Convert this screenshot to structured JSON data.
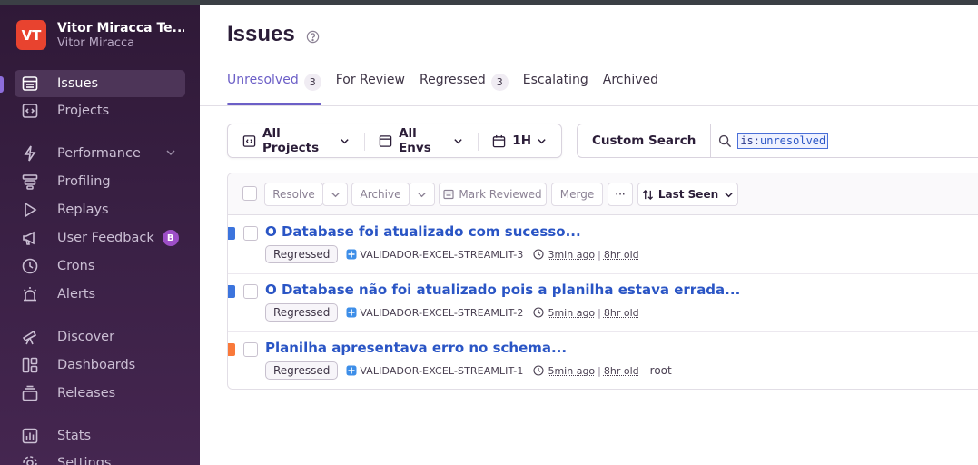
{
  "org": {
    "initials": "VT",
    "name": "Vitor Miracca Te...",
    "user": "Vitor Miracca"
  },
  "sidebar": {
    "items": [
      {
        "label": "Issues",
        "icon": "issues-icon"
      },
      {
        "label": "Projects",
        "icon": "projects-icon"
      },
      {
        "label": "Performance",
        "icon": "lightning-icon"
      },
      {
        "label": "Profiling",
        "icon": "profiling-icon"
      },
      {
        "label": "Replays",
        "icon": "play-icon"
      },
      {
        "label": "User Feedback",
        "icon": "megaphone-icon",
        "badge": "B"
      },
      {
        "label": "Crons",
        "icon": "clock-icon"
      },
      {
        "label": "Alerts",
        "icon": "siren-icon"
      },
      {
        "label": "Discover",
        "icon": "telescope-icon"
      },
      {
        "label": "Dashboards",
        "icon": "dashboard-icon"
      },
      {
        "label": "Releases",
        "icon": "releases-icon"
      },
      {
        "label": "Stats",
        "icon": "stats-icon"
      },
      {
        "label": "Settings",
        "icon": "gear-icon"
      }
    ]
  },
  "header": {
    "title": "Issues"
  },
  "tabs": [
    {
      "label": "Unresolved",
      "count": "3"
    },
    {
      "label": "For Review"
    },
    {
      "label": "Regressed",
      "count": "3"
    },
    {
      "label": "Escalating"
    },
    {
      "label": "Archived"
    }
  ],
  "filters": {
    "projects": "All Projects",
    "envs": "All Envs",
    "period": "1H"
  },
  "search": {
    "custom": "Custom Search",
    "token_key": "is:",
    "token_value": "unresolved"
  },
  "actions": {
    "resolve": "Resolve",
    "archive": "Archive",
    "mark_reviewed": "Mark Reviewed",
    "merge": "Merge",
    "more": "···",
    "sort": "Last Seen"
  },
  "issues": [
    {
      "title": "O Database foi atualizado com sucesso...",
      "status": "Regressed",
      "project": "VALIDADOR-EXCEL-STREAMLIT-3",
      "last_seen": "3min ago",
      "age": "8hr old",
      "extra": "",
      "priority_color": "#3c74dd"
    },
    {
      "title": "O Database não foi atualizado pois a planilha estava errada...",
      "status": "Regressed",
      "project": "VALIDADOR-EXCEL-STREAMLIT-2",
      "last_seen": "5min ago",
      "age": "8hr old",
      "extra": "",
      "priority_color": "#3c74dd"
    },
    {
      "title": "Planilha apresentava erro no schema...",
      "status": "Regressed",
      "project": "VALIDADOR-EXCEL-STREAMLIT-1",
      "last_seen": "5min ago",
      "age": "8hr old",
      "extra": "root",
      "priority_color": "#f9793a"
    }
  ],
  "colors": {
    "accent": "#6c5fc7",
    "link": "#2a55c5",
    "brand": "#e8432f"
  }
}
